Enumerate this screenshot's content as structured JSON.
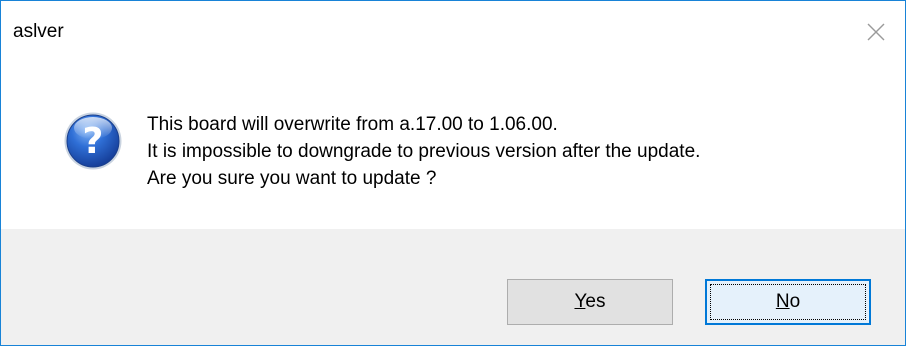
{
  "window": {
    "title": "aslver"
  },
  "message": {
    "lines": [
      "This board will overwrite from a.17.00 to 1.06.00.",
      "It is impossible to downgrade to previous version after the update.",
      "Are you sure you want to update ?"
    ]
  },
  "buttons": {
    "yes": {
      "mnemonic": "Y",
      "rest": "es"
    },
    "no": {
      "mnemonic": "N",
      "rest": "o"
    }
  },
  "icons": {
    "close": "close-icon",
    "message": "question-icon"
  },
  "colors": {
    "window_border": "#1883d7",
    "footer_bg": "#f0f0f0",
    "button_bg": "#e1e1e1",
    "default_button_border": "#0078d7",
    "icon_blue": "#1e5fc0"
  }
}
